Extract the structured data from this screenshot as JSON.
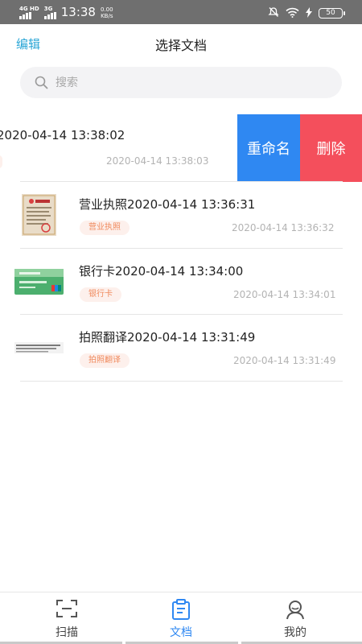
{
  "status_bar": {
    "network_1": "4G HD",
    "network_2": "3G",
    "time": "13:38",
    "speed_value": "0.00",
    "speed_unit": "KB/s",
    "battery": "50"
  },
  "header": {
    "edit_label": "编辑",
    "title": "选择文档"
  },
  "search": {
    "placeholder": "搜索"
  },
  "swiped_item": {
    "title": "2020-04-14 13:38:02",
    "time": "2020-04-14  13:38:03",
    "rename_label": "重命名",
    "delete_label": "删除"
  },
  "documents": [
    {
      "title": "营业执照2020-04-14 13:36:31",
      "tag": "营业执照",
      "time": "2020-04-14  13:36:32",
      "thumb": "business-license-thumbnail"
    },
    {
      "title": "银行卡2020-04-14 13:34:00",
      "tag": "银行卡",
      "time": "2020-04-14  13:34:01",
      "thumb": "bank-card-thumbnail"
    },
    {
      "title": "拍照翻译2020-04-14 13:31:49",
      "tag": "拍照翻译",
      "time": "2020-04-14  13:31:49",
      "thumb": "text-photo-thumbnail"
    }
  ],
  "bottom_nav": {
    "items": [
      {
        "label": "扫描",
        "icon": "scan-icon"
      },
      {
        "label": "文档",
        "icon": "document-icon"
      },
      {
        "label": "我的",
        "icon": "profile-icon"
      }
    ],
    "active_index": 1
  },
  "colors": {
    "accent": "#2f88f2",
    "edit_text": "#2aa6d6",
    "delete": "#f44f5c",
    "tag_text": "#f08a5d",
    "tag_bg": "#fdf0ec",
    "status_bar": "#6f6f6f"
  }
}
